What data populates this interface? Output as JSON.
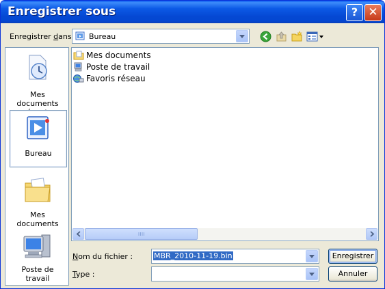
{
  "window": {
    "title": "Enregistrer sous",
    "help_label": "?",
    "close_label": "✕"
  },
  "save_in": {
    "label_prefix": "Enregistrer ",
    "label_accel": "d",
    "label_suffix": "ans :",
    "value": "Bureau"
  },
  "toolbar": {
    "icons": [
      "back-icon",
      "up-folder-icon",
      "new-folder-icon",
      "view-menu-icon"
    ]
  },
  "places": [
    {
      "label": "Mes documents récents",
      "icon": "recent-documents-icon"
    },
    {
      "label": "Bureau",
      "icon": "desktop-icon",
      "selected": true
    },
    {
      "label": "Mes documents",
      "icon": "my-documents-icon"
    },
    {
      "label": "Poste de travail",
      "icon": "my-computer-icon"
    }
  ],
  "files": [
    {
      "name": "Mes documents",
      "icon": "my-documents-icon"
    },
    {
      "name": "Poste de travail",
      "icon": "my-computer-icon"
    },
    {
      "name": "Favoris réseau",
      "icon": "network-places-icon"
    }
  ],
  "filename": {
    "label_accel": "N",
    "label_rest": "om du fichier :",
    "value": "MBR_2010-11-19.bin"
  },
  "filetype": {
    "label_accel": "T",
    "label_rest": "ype :",
    "value": ""
  },
  "buttons": {
    "save": "Enregistrer",
    "cancel": "Annuler"
  },
  "colors": {
    "title_bar": "#0a54e3",
    "selection": "#316ac5",
    "dialog_bg": "#ece9d8",
    "border": "#7f9db9"
  }
}
